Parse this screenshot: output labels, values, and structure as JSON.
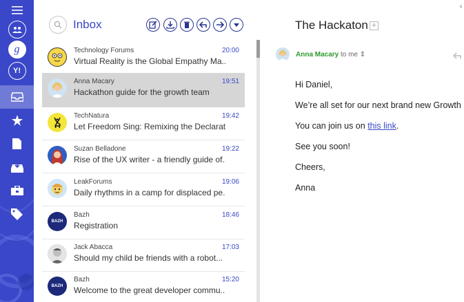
{
  "list": {
    "title": "Inbox",
    "toolbar": [
      "compose-icon",
      "download-icon",
      "delete-icon",
      "reply-icon",
      "forward-icon",
      "more-icon"
    ]
  },
  "messages": [
    {
      "sender": "Technology Forums",
      "subject": "Virtual Reality is the Global Empathy Ma...",
      "time": "20:00",
      "avatar": "emoji-face",
      "selected": false
    },
    {
      "sender": "Anna Macary",
      "subject": "Hackathon guide for the growth team",
      "time": "19:51",
      "avatar": "photo-woman-blonde",
      "selected": true
    },
    {
      "sender": "TechNatura",
      "subject": "Let Freedom Sing: Remixing the Declarati...",
      "time": "19:42",
      "avatar": "yellow-deer",
      "selected": false
    },
    {
      "sender": "Suzan Belladone",
      "subject": "Rise of the UX writer - a friendly guide of...",
      "time": "19:22",
      "avatar": "illustrated-woman",
      "selected": false
    },
    {
      "sender": "LeakForums",
      "subject": "Daily rhythms in a camp for displaced pe...",
      "time": "19:06",
      "avatar": "cartoon-face",
      "selected": false
    },
    {
      "sender": "Bazh",
      "subject": "Registration",
      "time": "18:46",
      "avatar": "bazh-logo",
      "avatar_text": "BAZH",
      "selected": false
    },
    {
      "sender": "Jack Abacca",
      "subject": "Should my child be friends with a robot...",
      "time": "17:03",
      "avatar": "photo-man",
      "selected": false
    },
    {
      "sender": "Bazh",
      "subject": "Welcome to the great developer commu...",
      "time": "15:20",
      "avatar": "bazh-logo",
      "avatar_text": "BAZH",
      "selected": false
    }
  ],
  "reader": {
    "title": "The Hackaton",
    "from_name": "Anna Macary",
    "to": "to me",
    "greeting": "Hi Daniel,",
    "line1": "We’re all set for our next brand new Growth",
    "line2_prefix": "You can join us on",
    "link_text": "this link",
    "line2_suffix": ".",
    "line3": "See you soon!",
    "closing": "Cheers,",
    "signature": "Anna"
  },
  "colors": {
    "accent": "#3a47c8",
    "rail": "#3a47c8",
    "sender_green": "#2e9a2e",
    "selected_row": "#d6d6d6"
  }
}
